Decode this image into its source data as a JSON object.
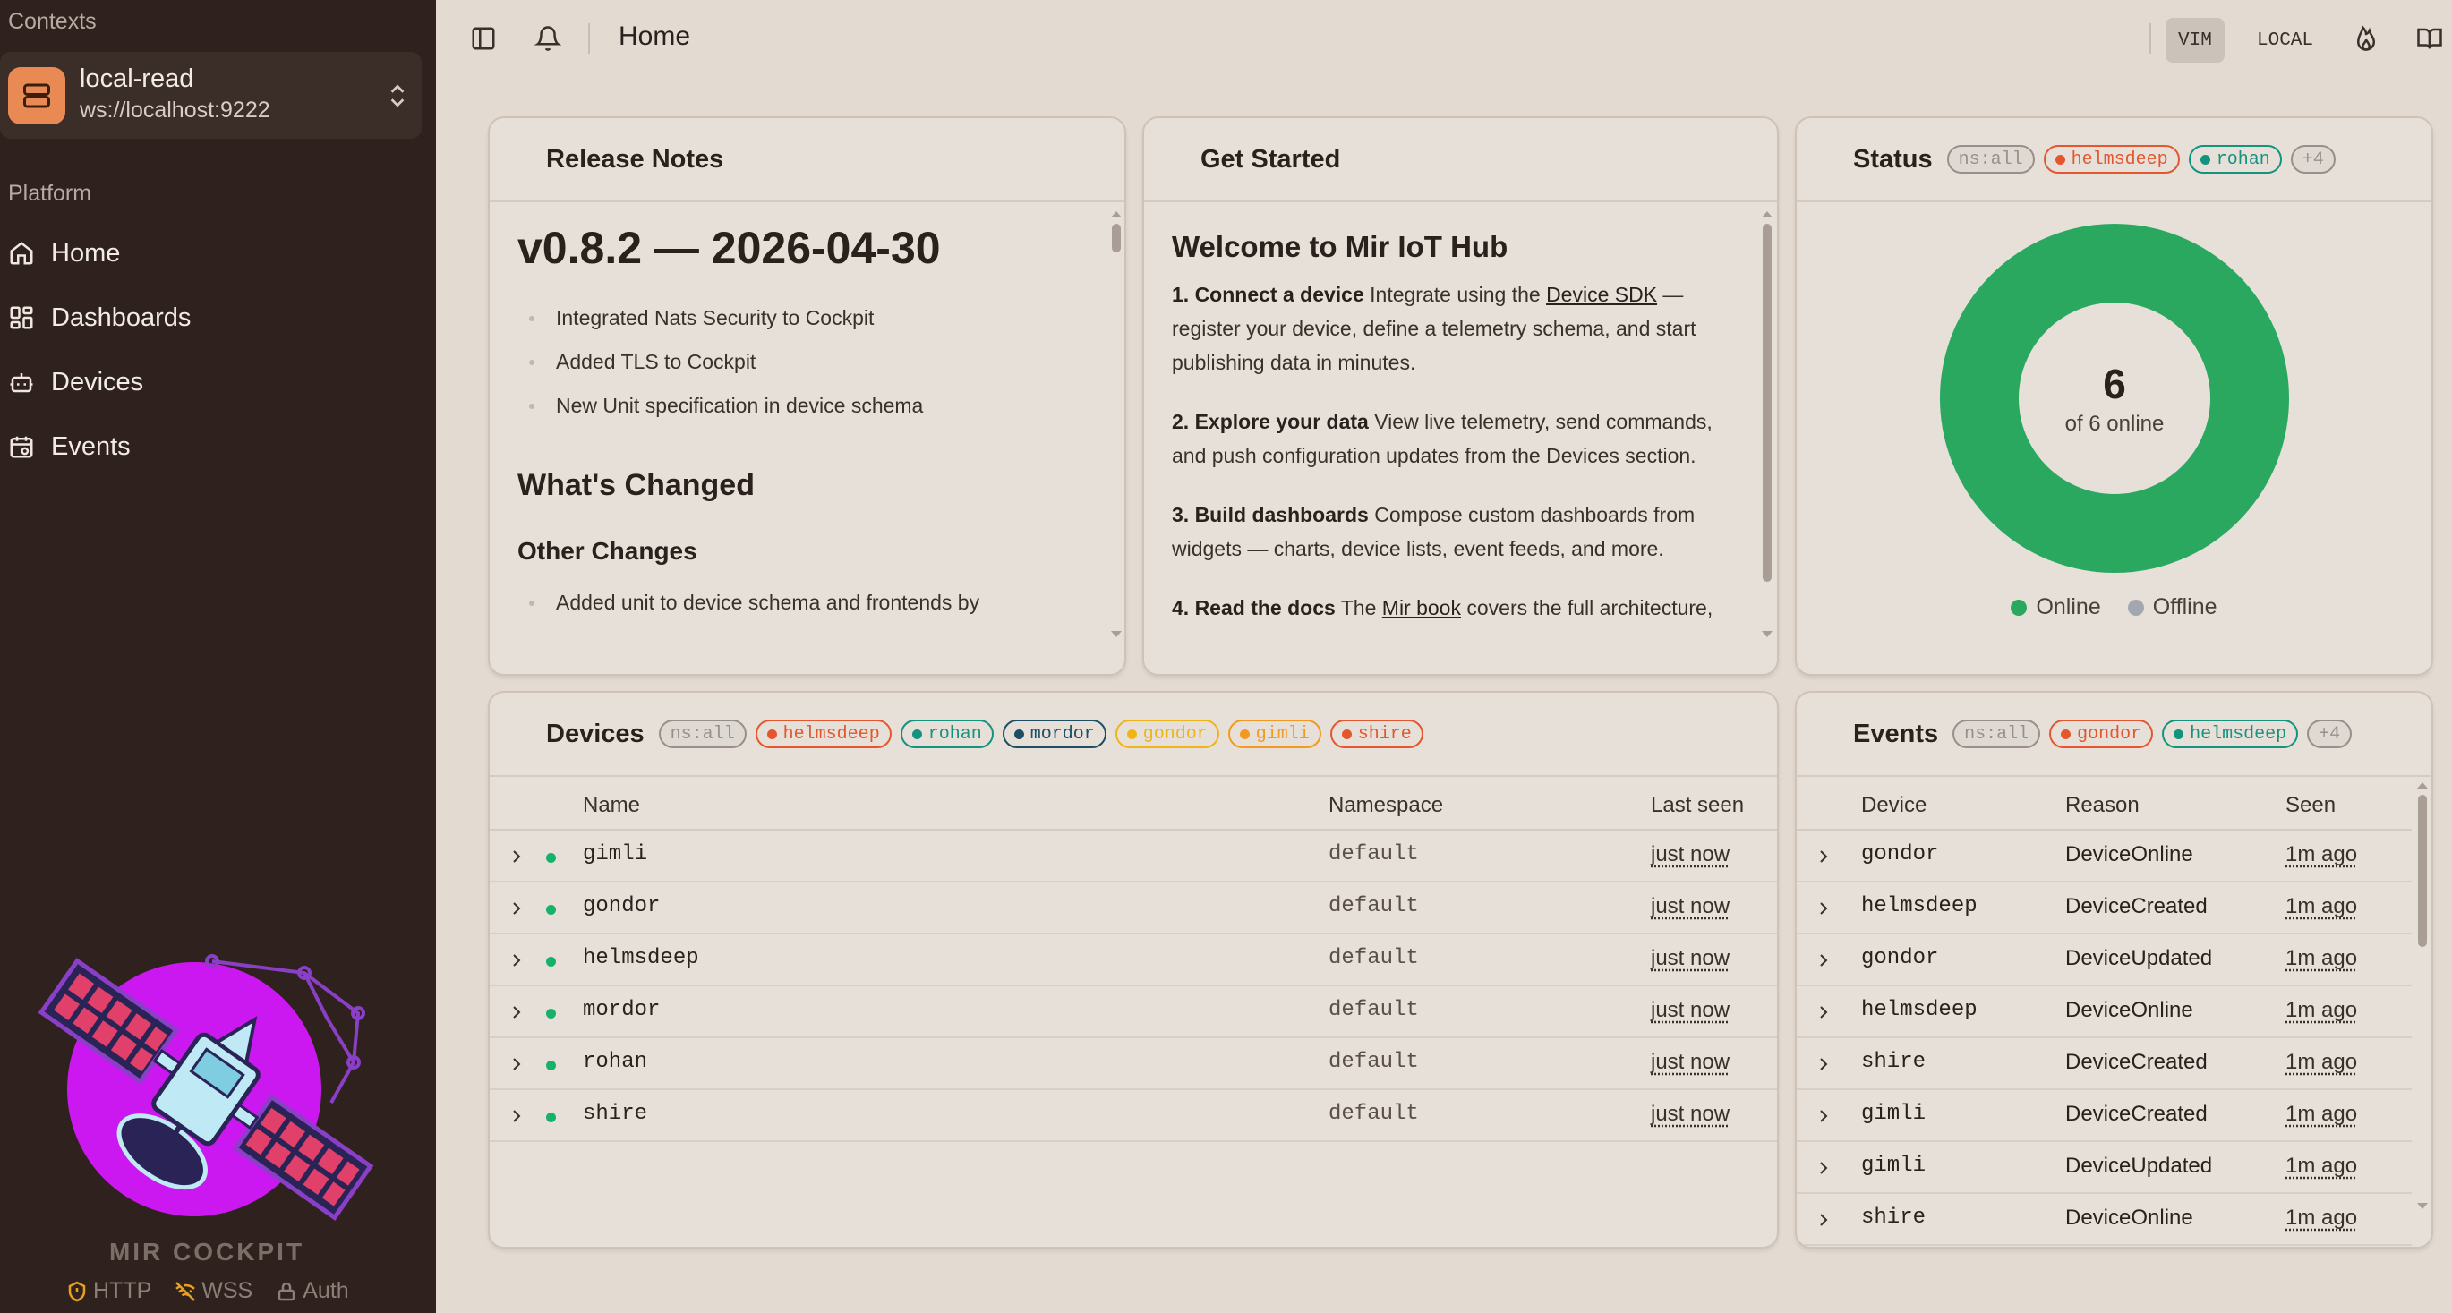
{
  "sidebar": {
    "contexts_label": "Contexts",
    "context": {
      "name": "local-read",
      "url": "ws://localhost:9222"
    },
    "section_label": "Platform",
    "items": [
      {
        "label": "Home",
        "icon": "home-icon"
      },
      {
        "label": "Dashboards",
        "icon": "dashboard-icon"
      },
      {
        "label": "Devices",
        "icon": "robot-icon"
      },
      {
        "label": "Events",
        "icon": "calendar-icon"
      }
    ],
    "brand": "MIR COCKPIT",
    "connections": [
      {
        "label": "HTTP",
        "icon": "shield-icon"
      },
      {
        "label": "WSS",
        "icon": "wifi-off-icon"
      },
      {
        "label": "Auth",
        "icon": "lock-icon"
      }
    ]
  },
  "topbar": {
    "title": "Home",
    "vim_label": "VIM",
    "local_label": "LOCAL"
  },
  "release_notes": {
    "title": "Release Notes",
    "version_heading": "v0.8.2 — 2026-04-30",
    "items": [
      "Integrated Nats Security to Cockpit",
      "Added TLS to Cockpit",
      "New Unit specification in device schema"
    ],
    "whats_changed": "What's Changed",
    "other_changes": "Other Changes",
    "other_items": [
      "Added unit to device schema and frontends by"
    ]
  },
  "get_started": {
    "title": "Get Started",
    "heading": "Welcome to Mir IoT Hub",
    "steps": [
      {
        "bold": "1. Connect a device",
        "pre": " Integrate using the ",
        "link": "Device SDK",
        "post": " — register your device, define a telemetry schema, and start publishing data in minutes."
      },
      {
        "bold": "2. Explore your data",
        "pre": " View live telemetry, send commands, and push configuration updates from the Devices section.",
        "link": "",
        "post": ""
      },
      {
        "bold": "3. Build dashboards",
        "pre": " Compose custom dashboards from widgets — charts, device lists, event feeds, and more.",
        "link": "",
        "post": ""
      },
      {
        "bold": "4. Read the docs",
        "pre": " The ",
        "link": "Mir book",
        "post": " covers the full architecture,"
      }
    ]
  },
  "status": {
    "title": "Status",
    "badges": [
      {
        "label": "ns:all",
        "color": "#9a8f88",
        "dot": false
      },
      {
        "label": "helmsdeep",
        "color": "#e4572e",
        "dot": true
      },
      {
        "label": "rohan",
        "color": "#14937f",
        "dot": true
      },
      {
        "label": "+4",
        "color": "#9a8f88",
        "dot": false
      }
    ],
    "online": 6,
    "total": 6,
    "center_value": "6",
    "center_label": "of 6 online",
    "legend": [
      {
        "label": "Online",
        "color": "#2aa860"
      },
      {
        "label": "Offline",
        "color": "#a3a8b0"
      }
    ]
  },
  "devices": {
    "title": "Devices",
    "badges": [
      {
        "label": "ns:all",
        "color": "#9a8f88",
        "dot": false
      },
      {
        "label": "helmsdeep",
        "color": "#e4572e",
        "dot": true
      },
      {
        "label": "rohan",
        "color": "#14937f",
        "dot": true
      },
      {
        "label": "mordor",
        "color": "#1d4e63",
        "dot": true
      },
      {
        "label": "gondor",
        "color": "#f1b417",
        "dot": true
      },
      {
        "label": "gimli",
        "color": "#f29a1f",
        "dot": true
      },
      {
        "label": "shire",
        "color": "#e4572e",
        "dot": true
      }
    ],
    "columns": [
      "Name",
      "Namespace",
      "Last seen"
    ],
    "rows": [
      {
        "name": "gimli",
        "namespace": "default",
        "last_seen": "just now"
      },
      {
        "name": "gondor",
        "namespace": "default",
        "last_seen": "just now"
      },
      {
        "name": "helmsdeep",
        "namespace": "default",
        "last_seen": "just now"
      },
      {
        "name": "mordor",
        "namespace": "default",
        "last_seen": "just now"
      },
      {
        "name": "rohan",
        "namespace": "default",
        "last_seen": "just now"
      },
      {
        "name": "shire",
        "namespace": "default",
        "last_seen": "just now"
      }
    ]
  },
  "events": {
    "title": "Events",
    "badges": [
      {
        "label": "ns:all",
        "color": "#9a8f88",
        "dot": false
      },
      {
        "label": "gondor",
        "color": "#e4572e",
        "dot": true
      },
      {
        "label": "helmsdeep",
        "color": "#14937f",
        "dot": true
      },
      {
        "label": "+4",
        "color": "#9a8f88",
        "dot": false
      }
    ],
    "columns": [
      "Device",
      "Reason",
      "Seen"
    ],
    "rows": [
      {
        "device": "gondor",
        "reason": "DeviceOnline",
        "seen": "1m ago"
      },
      {
        "device": "helmsdeep",
        "reason": "DeviceCreated",
        "seen": "1m ago"
      },
      {
        "device": "gondor",
        "reason": "DeviceUpdated",
        "seen": "1m ago"
      },
      {
        "device": "helmsdeep",
        "reason": "DeviceOnline",
        "seen": "1m ago"
      },
      {
        "device": "shire",
        "reason": "DeviceCreated",
        "seen": "1m ago"
      },
      {
        "device": "gimli",
        "reason": "DeviceCreated",
        "seen": "1m ago"
      },
      {
        "device": "gimli",
        "reason": "DeviceUpdated",
        "seen": "1m ago"
      },
      {
        "device": "shire",
        "reason": "DeviceOnline",
        "seen": "1m ago"
      }
    ]
  }
}
